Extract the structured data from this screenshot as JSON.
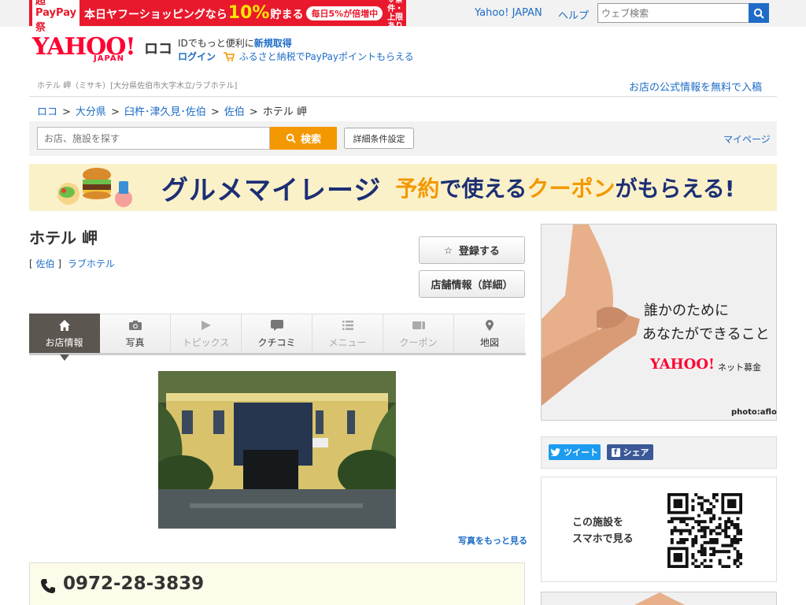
{
  "promo": {
    "logo": "超PayPay祭",
    "main_pre": "本日ヤフーショッピングなら",
    "percent": "10%",
    "main_post": "貯まる",
    "pill": "毎日5%が倍増中",
    "note_line1": "※条件・",
    "note_line2": "上限あり"
  },
  "top": {
    "yahoo_link": "Yahoo! JAPAN",
    "help_link": "ヘルプ",
    "search_placeholder": "ウェブ検索"
  },
  "header": {
    "logo_text": "YAHOO!",
    "logo_sub": "JAPAN",
    "service_name": "ロコ",
    "login_line1_pre": "IDでもっと便利に",
    "login_line1_link": "新規取得",
    "login_link": "ログイン",
    "furusato": "ふるさと納税でPayPayポイントもらえる",
    "subtitle": "ホテル 岬（ミサキ）[大分県佐伯市大字木立/ラブホテル]",
    "free_listing": "お店の公式情報を無料で入稿"
  },
  "breadcrumb": {
    "items": [
      "ロコ",
      "大分県",
      "臼杵･津久見･佐伯",
      "佐伯"
    ],
    "current": "ホテル 岬",
    "sep": ">"
  },
  "search": {
    "placeholder": "お店、施設を探す",
    "button": "検索",
    "detail_button": "詳細条件設定",
    "mypage": "マイページ"
  },
  "banner": {
    "text1": "グルメマイレージ",
    "t2a": "予約",
    "t2b": "で使える",
    "t2c": "クーポン",
    "t2d": "がもらえる!"
  },
  "hotel": {
    "name": "ホテル 岬",
    "tag_open": "[",
    "area": "佐伯",
    "tag_close": "]",
    "category": "ラブホテル",
    "register_button": "登録する",
    "store_info_button": "店舗情報（詳細）",
    "more_photos": "写真をもっと見る",
    "phone": "0972-28-3839"
  },
  "tabs": [
    {
      "label": "お店情報",
      "icon": "home-icon",
      "state": "active"
    },
    {
      "label": "写真",
      "icon": "camera-icon",
      "state": "normal"
    },
    {
      "label": "トピックス",
      "icon": "flag-icon",
      "state": "disabled"
    },
    {
      "label": "クチコミ",
      "icon": "speech-bubble-icon",
      "state": "normal"
    },
    {
      "label": "メニュー",
      "icon": "list-icon",
      "state": "disabled"
    },
    {
      "label": "クーポン",
      "icon": "ticket-icon",
      "state": "disabled"
    },
    {
      "label": "地図",
      "icon": "map-pin-icon",
      "state": "normal"
    }
  ],
  "ad": {
    "line1": "誰かのために",
    "line2": "あなたができること",
    "brand": "YAHOO!",
    "brand_sub": "ネット募金",
    "credit": "photo:aflo"
  },
  "share": {
    "tweet": "ツイート",
    "facebook": "シェア"
  },
  "qr": {
    "line1": "この施設を",
    "line2": "スマホで見る"
  },
  "colors": {
    "link": "#1e6cc7",
    "promo_red": "#e8192c",
    "search_orange": "#f39800",
    "tab_active": "#5c5650",
    "banner_navy": "#1c2f74",
    "twitter": "#1d9bf0",
    "facebook": "#3b5998"
  }
}
